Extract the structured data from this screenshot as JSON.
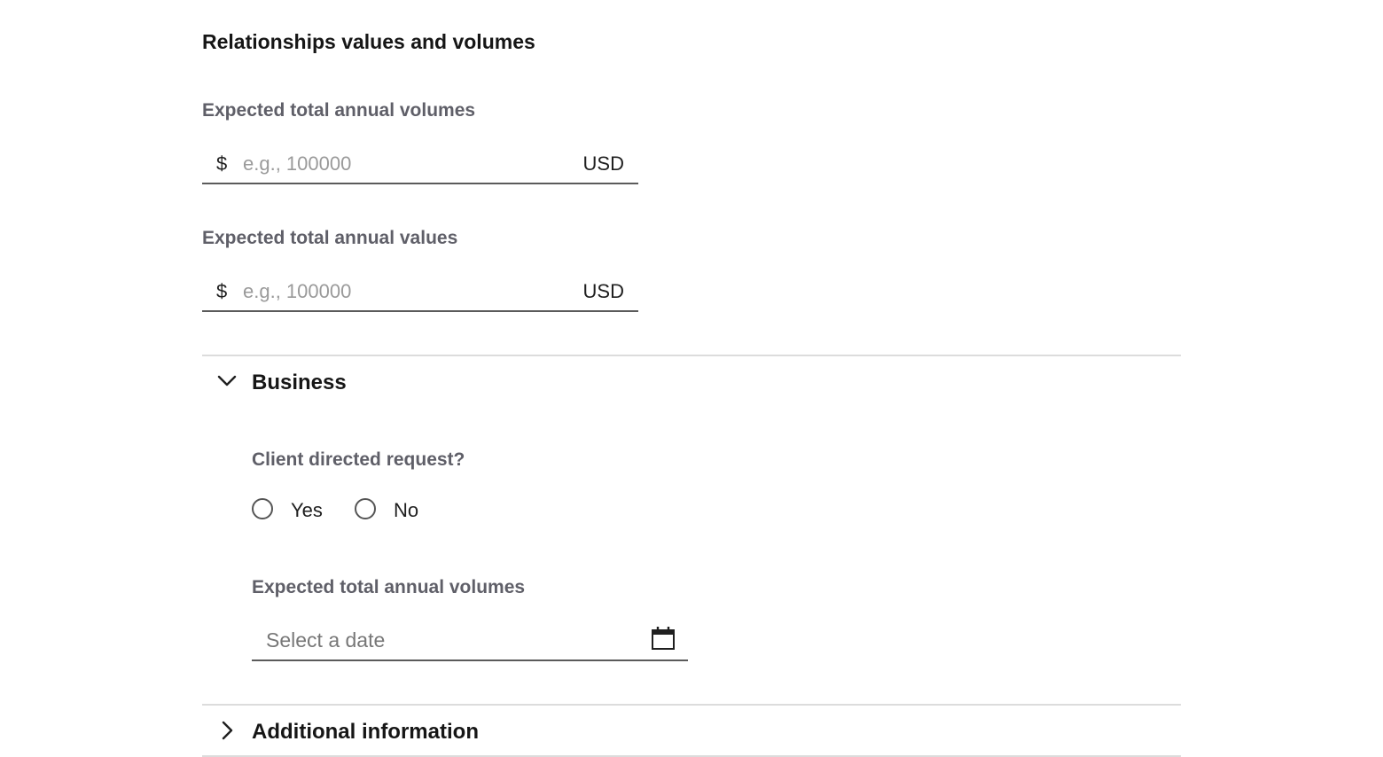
{
  "section": {
    "title": "Relationships values and volumes"
  },
  "volumes_field": {
    "label": "Expected total annual volumes",
    "prefix": "$",
    "placeholder": "e.g., 100000",
    "value": "",
    "suffix": "USD"
  },
  "values_field": {
    "label": "Expected total annual values",
    "prefix": "$",
    "placeholder": "e.g., 100000",
    "value": "",
    "suffix": "USD"
  },
  "business": {
    "title": "Business",
    "expanded": true,
    "question": "Client directed request?",
    "options": [
      {
        "label": "Yes",
        "selected": false
      },
      {
        "label": "No",
        "selected": false
      }
    ],
    "date_field": {
      "label": "Expected total annual volumes",
      "placeholder": "Select a date",
      "value": "",
      "icon": "calendar-icon"
    }
  },
  "additional": {
    "title": "Additional information",
    "expanded": false
  },
  "icons": {
    "expanded": "chevron-down-icon",
    "collapsed": "chevron-right-icon"
  }
}
